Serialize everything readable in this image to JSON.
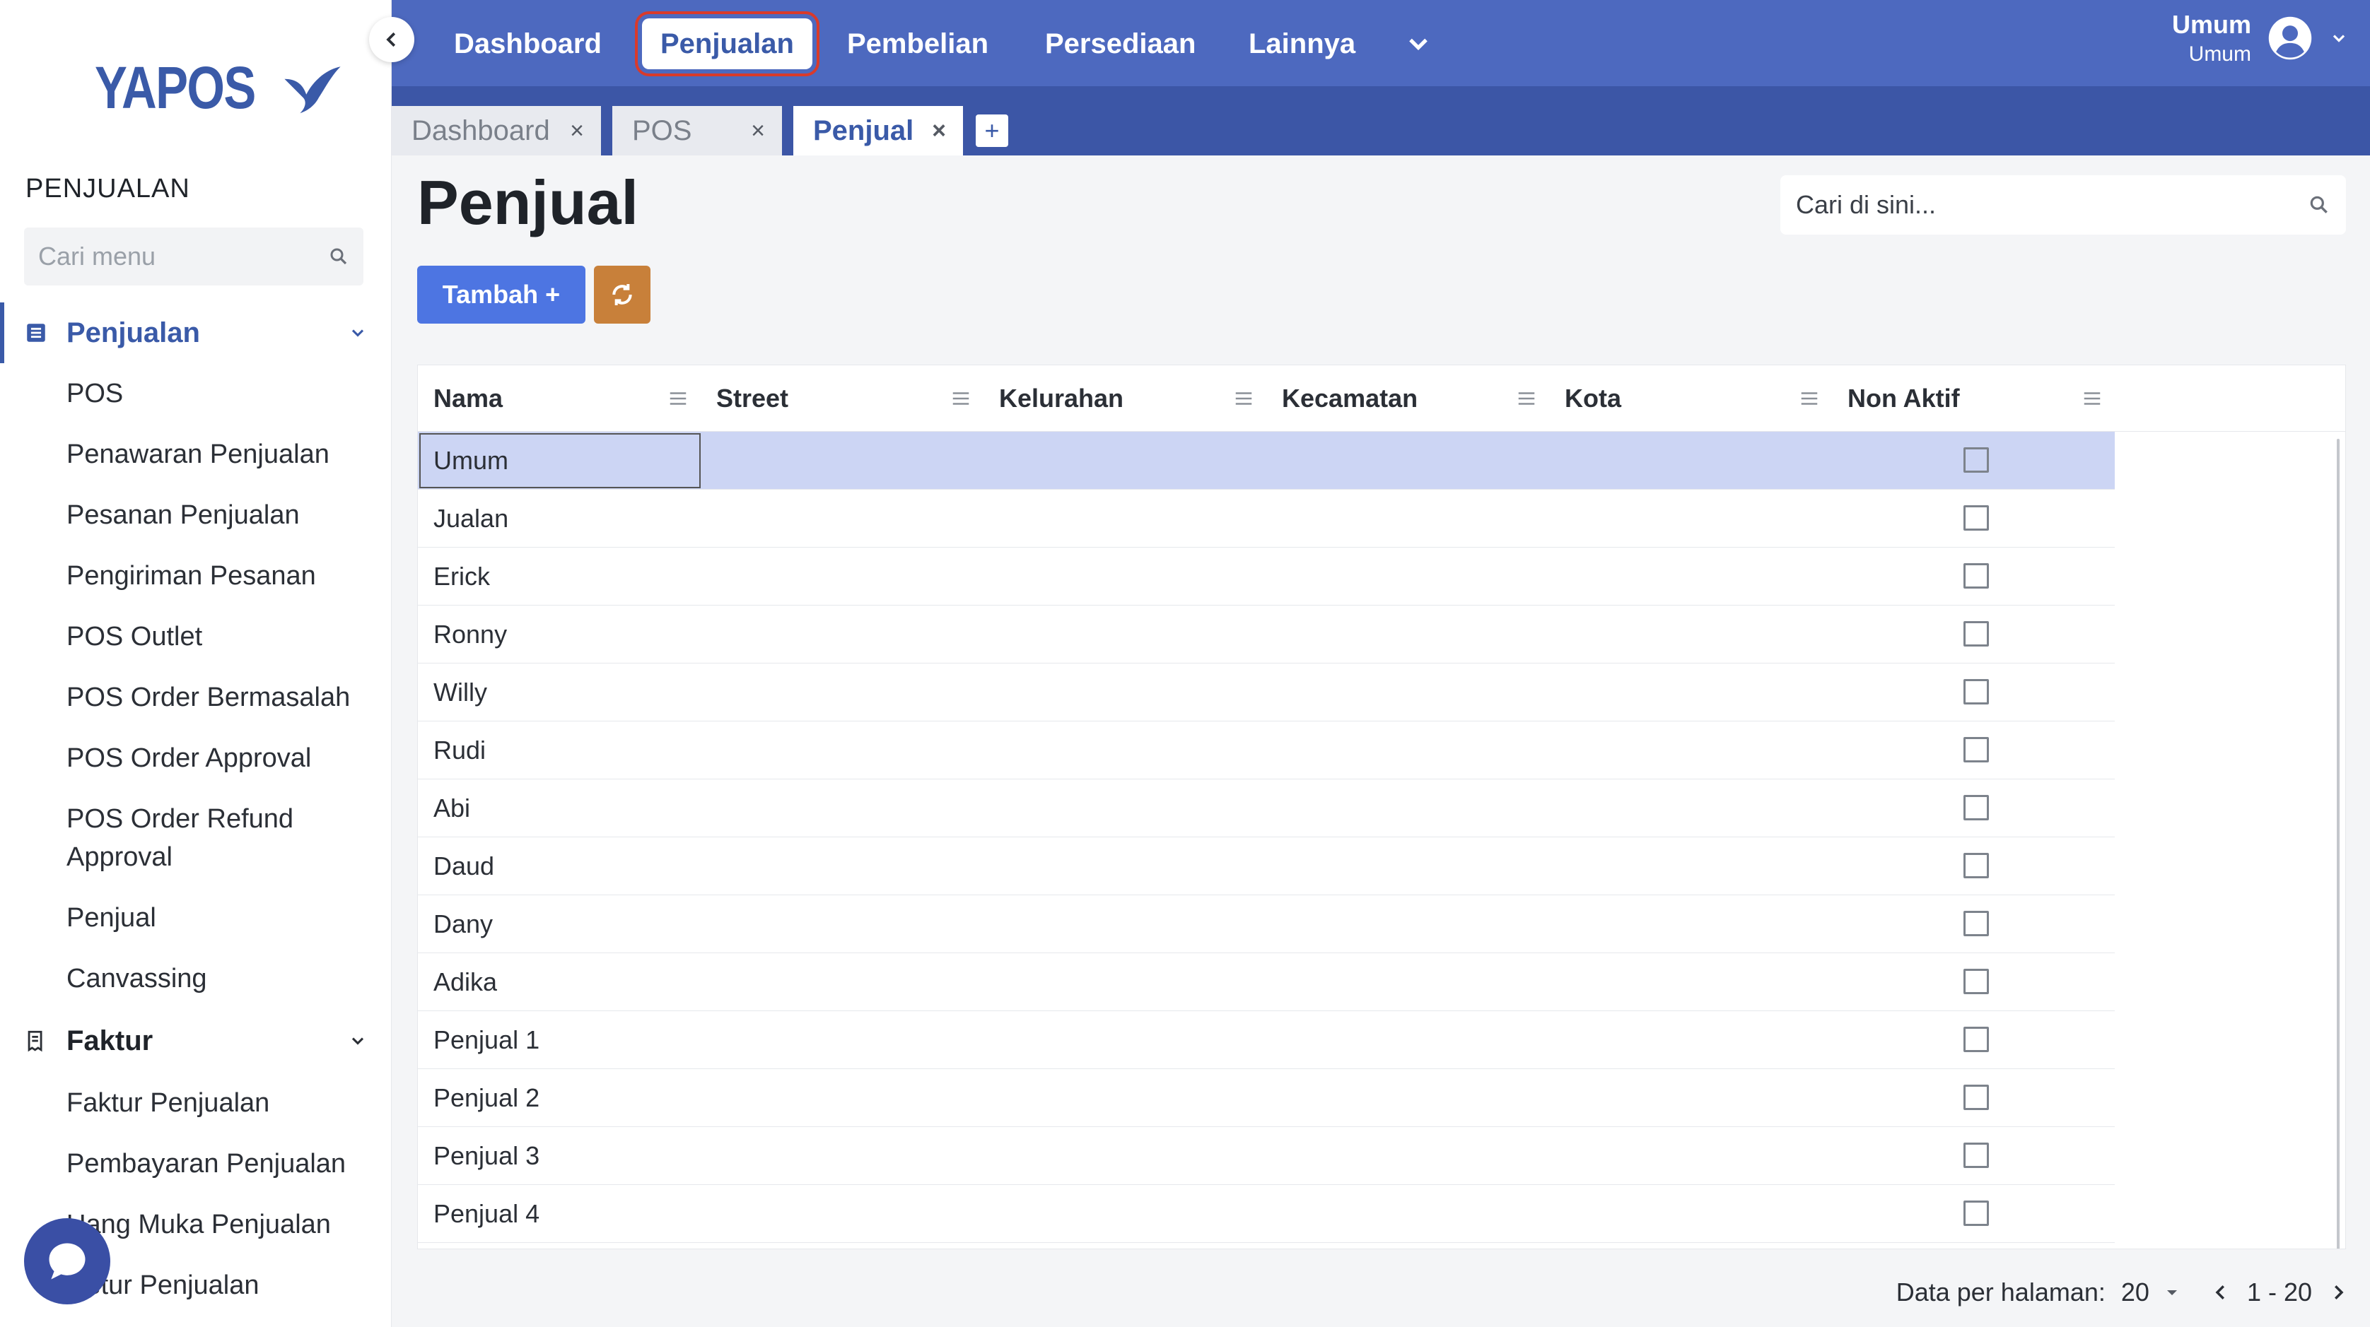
{
  "brand": {
    "logo_text": "YAPOS"
  },
  "sidebar": {
    "section_title": "PENJUALAN",
    "search_placeholder": "Cari menu",
    "groups": [
      {
        "label": "Penjualan",
        "items": [
          "POS",
          "Penawaran Penjualan",
          "Pesanan Penjualan",
          "Pengiriman Pesanan",
          "POS Outlet",
          "POS Order Bermasalah",
          "POS Order Approval",
          "POS Order Refund",
          "Approval",
          "Penjual",
          "Canvassing"
        ]
      },
      {
        "label": "Faktur",
        "items": [
          "Faktur Penjualan",
          "Pembayaran Penjualan",
          "Uang Muka Penjualan",
          "Retur Penjualan"
        ]
      }
    ]
  },
  "topnav": {
    "items": [
      "Dashboard",
      "Penjualan",
      "Pembelian",
      "Persediaan",
      "Lainnya"
    ],
    "active": "Penjualan",
    "user_name": "Umum",
    "user_role": "Umum"
  },
  "tabs": [
    {
      "label": "Dashboard"
    },
    {
      "label": "POS"
    },
    {
      "label": "Penjual"
    }
  ],
  "tab_close": "×",
  "tab_add": "+",
  "page": {
    "title": "Penjual",
    "search_placeholder": "Cari di sini...",
    "add_button": "Tambah +"
  },
  "table": {
    "columns": [
      "Nama",
      "Street",
      "Kelurahan",
      "Kecamatan",
      "Kota",
      "Non Aktif"
    ],
    "rows": [
      "Umum",
      "Jualan",
      "Erick",
      "Ronny",
      "Willy",
      "Rudi",
      "Abi",
      "Daud",
      "Dany",
      "Adika",
      "Penjual 1",
      "Penjual 2",
      "Penjual 3",
      "Penjual 4"
    ],
    "selected_row": "Umum"
  },
  "pager": {
    "label": "Data per halaman:",
    "page_size": "20",
    "range": "1 - 20"
  },
  "colors": {
    "primary": "#4d69bf",
    "tabbar": "#3c56a6",
    "accent_button": "#4d75e2",
    "refresh_button": "#c8803a",
    "selected_row": "#ccd5f4"
  },
  "icons": [
    "chevron-left-icon",
    "search-icon",
    "list-icon",
    "receipt-icon",
    "chevron-down-icon",
    "user-circle-icon",
    "refresh-icon",
    "column-menu-icon",
    "chat-icon",
    "chevron-right-icon"
  ]
}
